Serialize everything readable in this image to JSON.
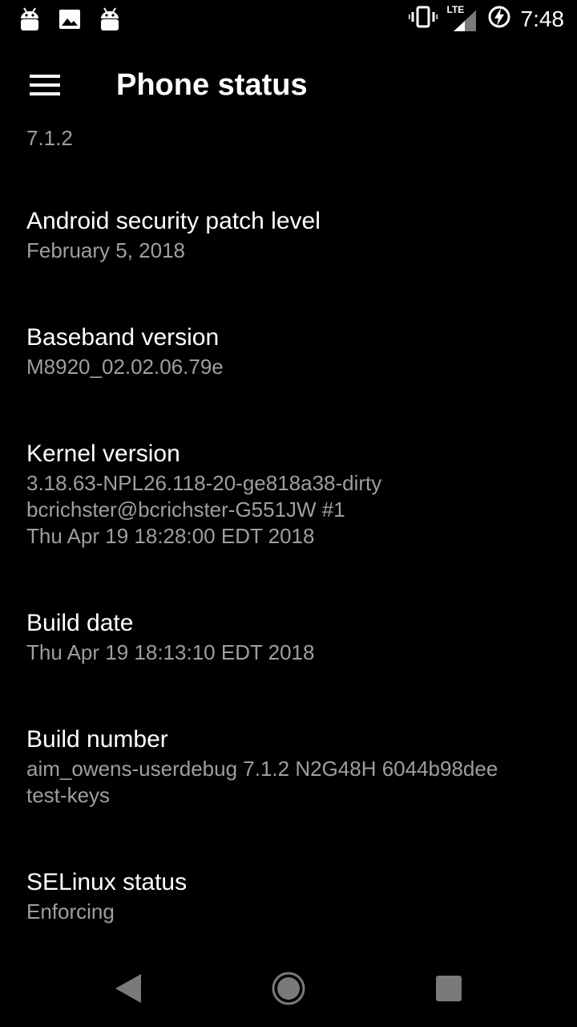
{
  "status_bar": {
    "time": "7:48",
    "network_label": "LTE",
    "icons_left": [
      "android-icon",
      "image-icon",
      "android-icon"
    ],
    "icons_right": [
      "vibrate-icon",
      "signal-icon",
      "battery-charging-icon"
    ]
  },
  "app_bar": {
    "title": "Phone status",
    "menu_icon": "menu-icon"
  },
  "content": {
    "version_tail": "7.1.2",
    "items": [
      {
        "title": "Android security patch level",
        "value": "February 5, 2018"
      },
      {
        "title": "Baseband version",
        "value": "M8920_02.02.06.79e"
      },
      {
        "title": "Kernel version",
        "value": "3.18.63-NPL26.118-20-ge818a38-dirty\nbcrichster@bcrichster-G551JW #1\nThu Apr 19 18:28:00 EDT 2018"
      },
      {
        "title": "Build date",
        "value": "Thu Apr 19 18:13:10 EDT 2018"
      },
      {
        "title": "Build number",
        "value": "aim_owens-userdebug 7.1.2 N2G48H 6044b98dee\ntest-keys"
      },
      {
        "title": "SELinux status",
        "value": "Enforcing"
      }
    ]
  },
  "nav_bar": {
    "back_icon": "back-icon",
    "home_icon": "home-icon",
    "recents_icon": "recents-icon"
  },
  "colors": {
    "background": "#000000",
    "primary_text": "#ffffff",
    "secondary_text": "#9e9e9e",
    "nav_icon": "#7a7a7a"
  }
}
